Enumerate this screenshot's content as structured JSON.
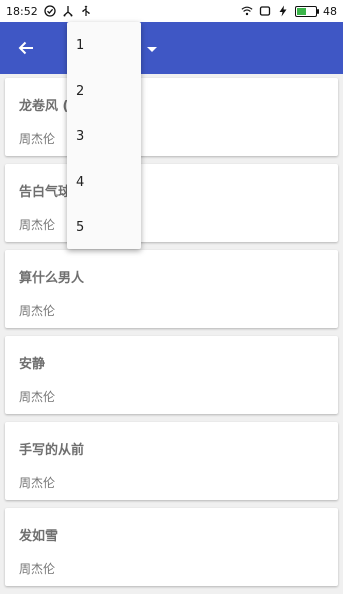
{
  "status_bar": {
    "time": "18:52",
    "battery_level": "48",
    "left_icons": [
      "check-circle-icon",
      "usb-debug-icon",
      "usb-icon"
    ],
    "right_icons": [
      "wifi-icon",
      "screen-icon",
      "charging-icon",
      "battery-icon"
    ]
  },
  "app_bar": {
    "color": "#3f57c5",
    "back_icon": "arrow-back-icon",
    "spinner_icon": "caret-down-icon"
  },
  "songs": [
    {
      "title": "龙卷风 (",
      "artist": "周杰伦"
    },
    {
      "title": "告白气球",
      "artist": "周杰伦"
    },
    {
      "title": "算什么男人",
      "artist": "周杰伦"
    },
    {
      "title": "安静",
      "artist": "周杰伦"
    },
    {
      "title": "手写的从前",
      "artist": "周杰伦"
    },
    {
      "title": "发如雪",
      "artist": "周杰伦"
    }
  ],
  "dropdown": {
    "options": [
      "1",
      "2",
      "3",
      "4",
      "5"
    ]
  }
}
